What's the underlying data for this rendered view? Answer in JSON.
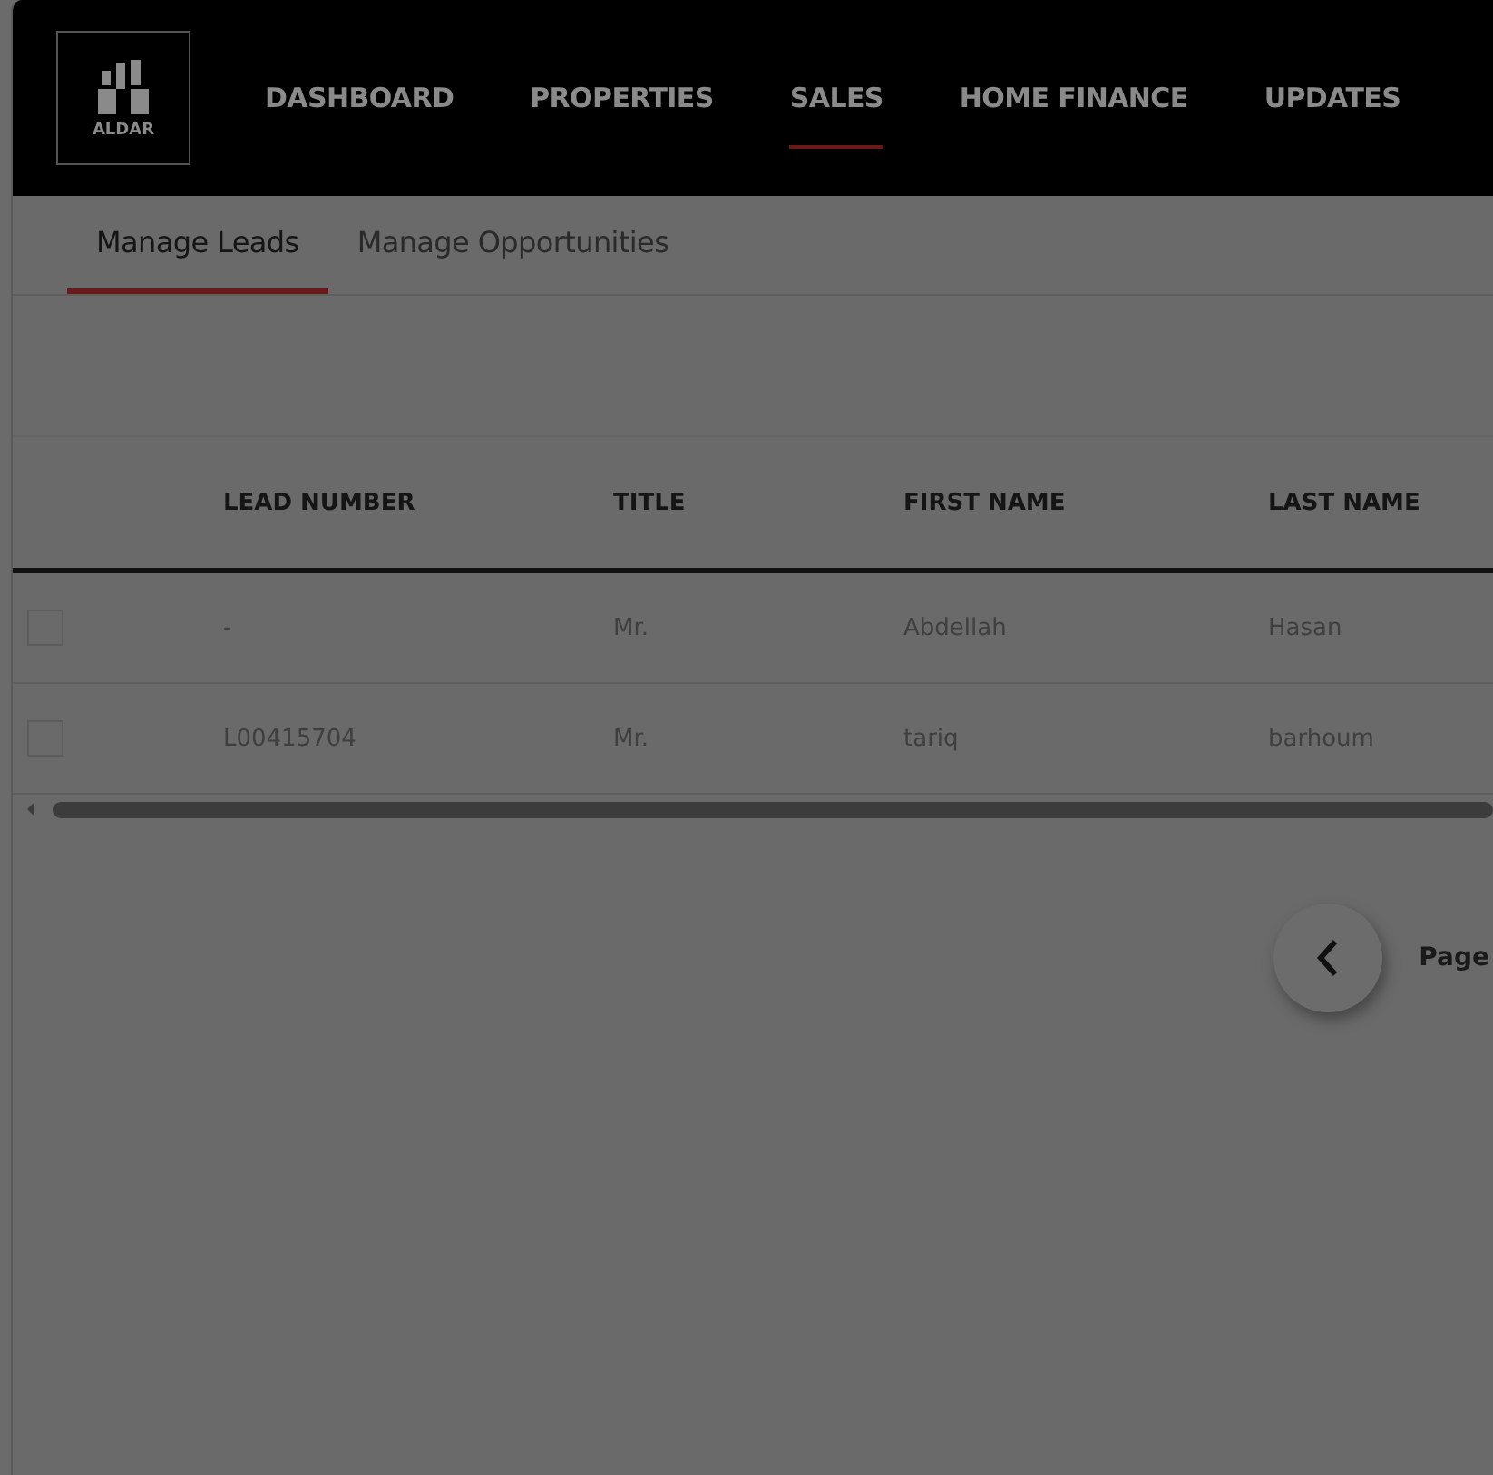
{
  "logo": {
    "text": "ALDAR"
  },
  "nav": [
    {
      "label": "DASHBOARD",
      "selected": false
    },
    {
      "label": "PROPERTIES",
      "selected": false
    },
    {
      "label": "SALES",
      "selected": true
    },
    {
      "label": "HOME FINANCE",
      "selected": false
    },
    {
      "label": "UPDATES",
      "selected": false
    }
  ],
  "subtabs": [
    {
      "label": "Manage Leads",
      "selected": true
    },
    {
      "label": "Manage Opportunities",
      "selected": false
    }
  ],
  "table": {
    "columns": [
      "LEAD NUMBER",
      "TITLE",
      "FIRST NAME",
      "LAST NAME"
    ],
    "rows": [
      {
        "checked": false,
        "cells": [
          "-",
          "Mr.",
          "Abdellah",
          "Hasan"
        ]
      },
      {
        "checked": false,
        "cells": [
          "L00415704",
          "Mr.",
          "tariq",
          "barhoum"
        ]
      }
    ]
  },
  "pagination": {
    "label": "Page"
  }
}
